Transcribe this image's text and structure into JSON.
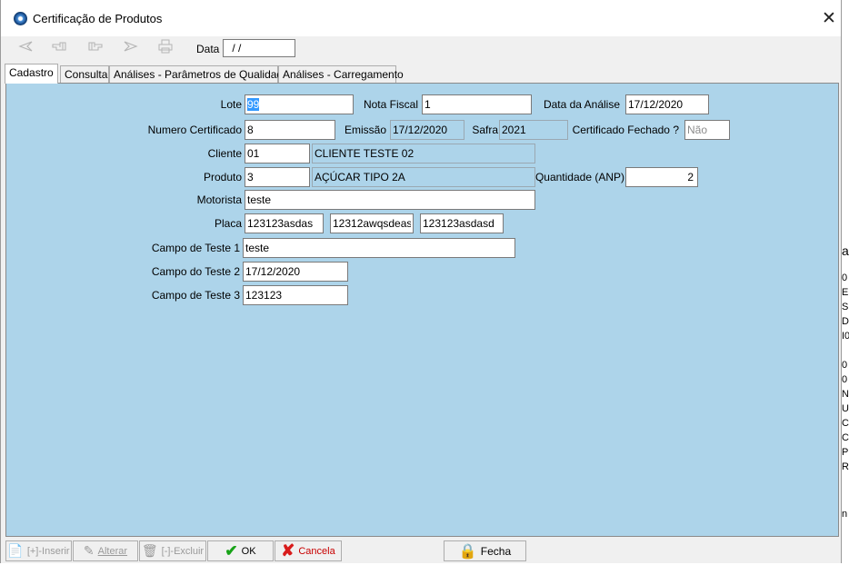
{
  "window": {
    "title": "Certificação de Produtos",
    "close_glyph": "✕"
  },
  "toolbar": {
    "icons": [
      "arrow-left-icon",
      "hand-left-icon",
      "hand-right-icon",
      "arrow-right-icon",
      "printer-icon"
    ],
    "data_label": "Data",
    "data_value": " / /"
  },
  "tabs": [
    {
      "label": "Cadastro",
      "active": true
    },
    {
      "label": "Consulta"
    },
    {
      "label": "Análises - Parâmetros de Qualidade"
    },
    {
      "label": "Análises - Carregamento"
    }
  ],
  "form": {
    "lote": {
      "label": "Lote",
      "value": "99"
    },
    "nota_fiscal": {
      "label": "Nota Fiscal",
      "value": "1"
    },
    "data_analise": {
      "label": "Data da Análise",
      "value": "17/12/2020"
    },
    "numero_certificado": {
      "label": "Numero Certificado",
      "value": "8"
    },
    "emissao": {
      "label": "Emissão",
      "value": "17/12/2020"
    },
    "safra": {
      "label": "Safra",
      "value": "2021"
    },
    "certificado_fechado": {
      "label": "Certificado Fechado ?",
      "value": "Não"
    },
    "cliente": {
      "label": "Cliente",
      "code": "01",
      "name": "CLIENTE TESTE 02"
    },
    "produto": {
      "label": "Produto",
      "code": "3",
      "name": "AÇÚCAR TIPO 2A"
    },
    "quantidade": {
      "label": "Quantidade (ANP)",
      "value": "2"
    },
    "motorista": {
      "label": "Motorista",
      "value": "teste"
    },
    "placa": {
      "label": "Placa",
      "values": [
        "123123asdas",
        "12312awqsdeas",
        "123123asdasd"
      ]
    },
    "campo_teste_1": {
      "label": "Campo de Teste 1",
      "value": "teste"
    },
    "campo_teste_2": {
      "label": "Campo do Teste 2",
      "value": "17/12/2020"
    },
    "campo_teste_3": {
      "label": "Campo de Teste 3",
      "value": "123123"
    }
  },
  "buttons": {
    "inserir": "[+]-Inserir",
    "alterar": "Alterar",
    "excluir": "[-]-Excluir",
    "ok": "OK",
    "cancela": "Cancela",
    "fecha": "Fecha"
  },
  "background_window": {
    "fragments": [
      "a",
      "0",
      "E",
      "S",
      "D",
      "I0",
      "0",
      "0",
      "N",
      "U",
      "C",
      "C",
      "P",
      "R",
      "n"
    ]
  }
}
